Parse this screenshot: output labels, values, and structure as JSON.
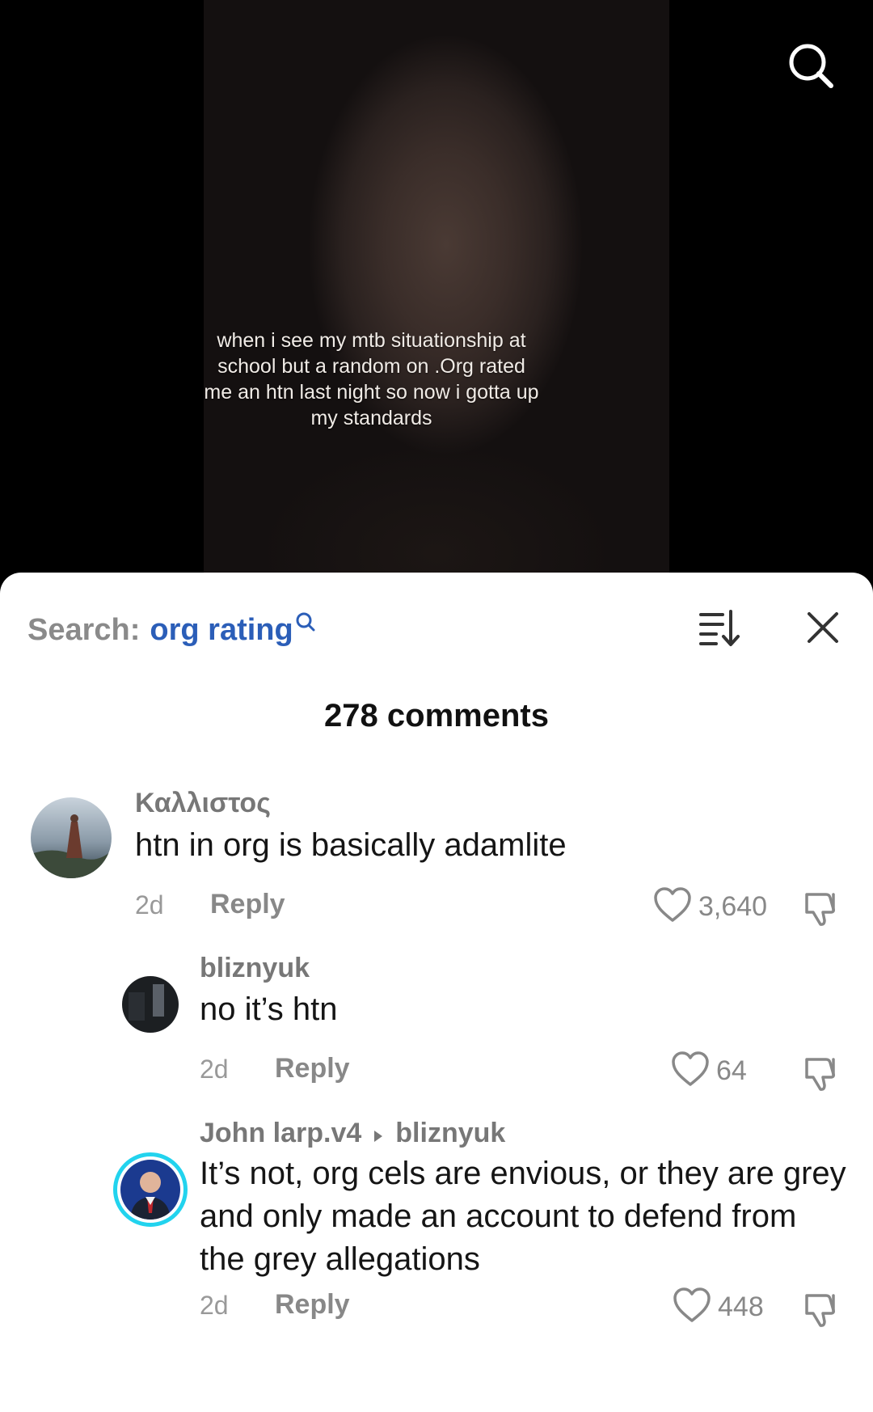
{
  "video": {
    "caption": "when i see my mtb situationship at school but a random on .Org rated me an htn last night so now i gotta up my standards"
  },
  "search": {
    "prefix": "Search:",
    "term": "org rating"
  },
  "comments_header": {
    "count_label": "278 comments"
  },
  "comments": [
    {
      "username": "Καλλιστος",
      "text": "htn in org is basically adamlite",
      "time": "2d",
      "reply_label": "Reply",
      "likes": "3,640"
    },
    {
      "username": "bliznyuk",
      "text": "no it’s htn",
      "time": "2d",
      "reply_label": "Reply",
      "likes": "64"
    },
    {
      "username": "John larp.v4",
      "reply_to": "bliznyuk",
      "text": "It’s not, org cels are envious, or they are grey and only made an account to defend from the grey allegations",
      "time": "2d",
      "reply_label": "Reply",
      "likes": "448"
    }
  ],
  "colors": {
    "accent": "#2b5eb8",
    "muted": "#888888",
    "story_ring": "#22d3ee"
  },
  "icons": [
    "search-icon",
    "sort-icon",
    "close-icon",
    "heart-icon",
    "thumbs-down-icon",
    "caret-right-icon"
  ]
}
